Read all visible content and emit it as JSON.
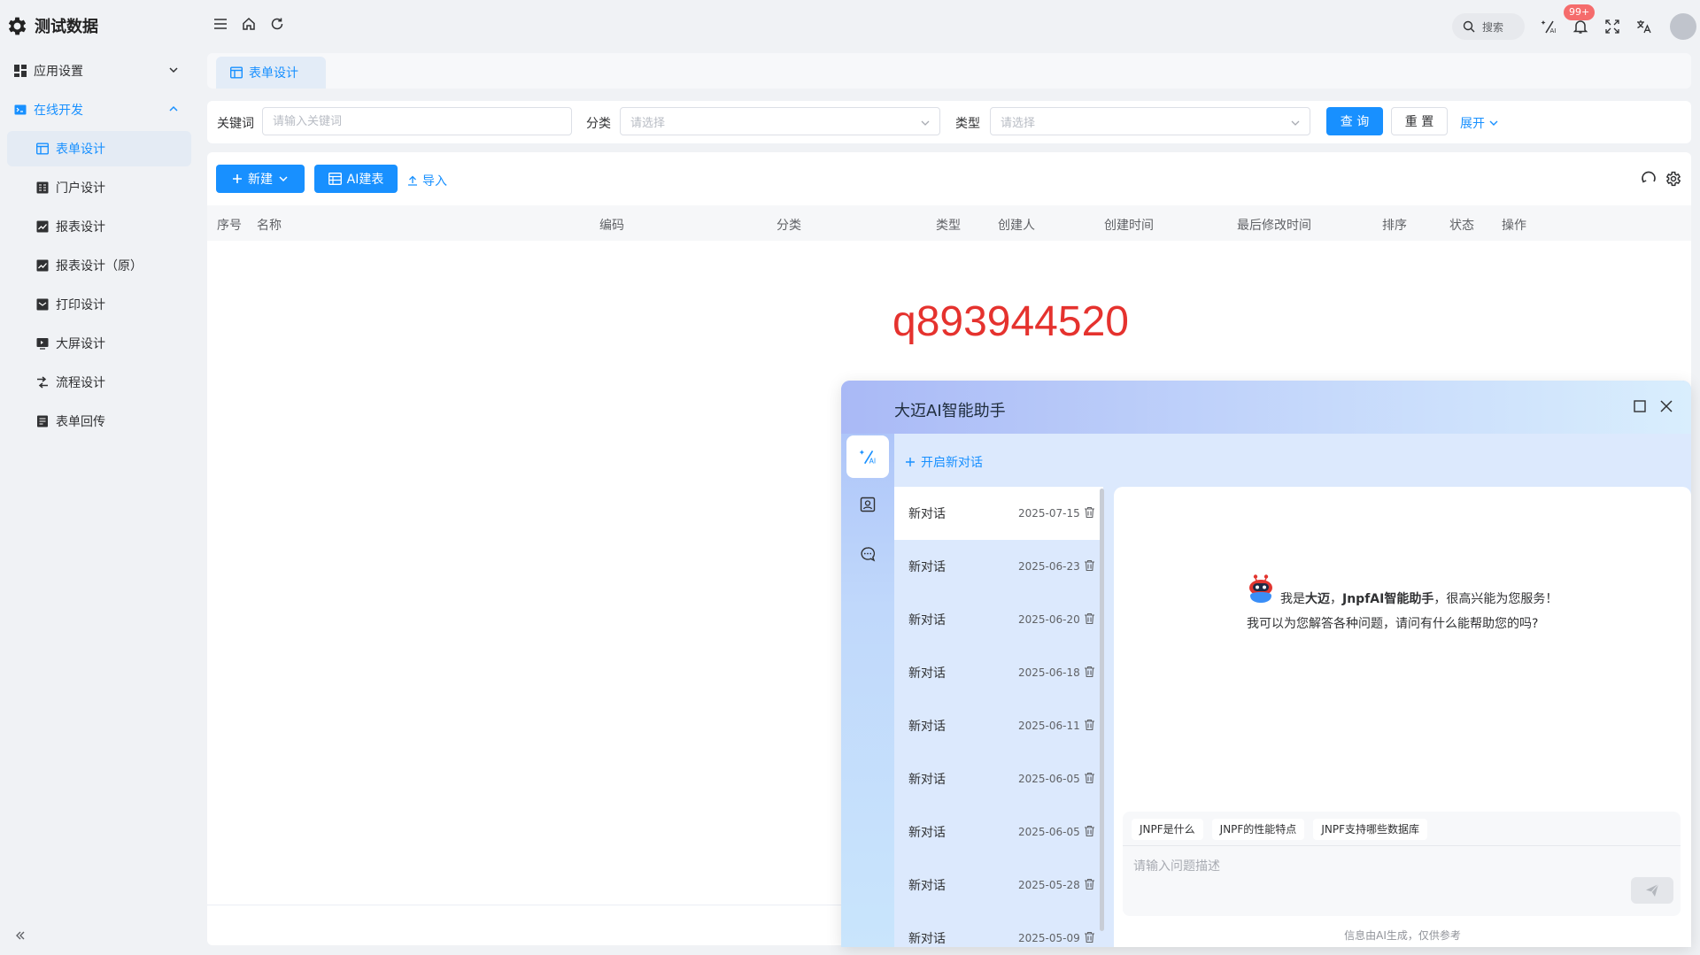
{
  "app": {
    "brand": "测试数据"
  },
  "sidebar": {
    "groups": [
      {
        "label": "应用设置"
      },
      {
        "label": "在线开发"
      }
    ],
    "items": [
      {
        "label": "表单设计"
      },
      {
        "label": "门户设计"
      },
      {
        "label": "报表设计"
      },
      {
        "label": "报表设计（原）"
      },
      {
        "label": "打印设计"
      },
      {
        "label": "大屏设计"
      },
      {
        "label": "流程设计"
      },
      {
        "label": "表单回传"
      }
    ]
  },
  "header": {
    "search_label": "搜索",
    "notification_badge": "99+"
  },
  "tabs": [
    {
      "label": "表单设计"
    }
  ],
  "search_form": {
    "keyword_label": "关键词",
    "keyword_placeholder": "请输入关键词",
    "category_label": "分类",
    "category_placeholder": "请选择",
    "type_label": "类型",
    "type_placeholder": "请选择",
    "query_label": "查 询",
    "reset_label": "重 置",
    "expand_label": "展开"
  },
  "toolbar": {
    "new_label": "新建",
    "ai_table_label": "AI建表",
    "import_label": "导入"
  },
  "table": {
    "columns": [
      "序号",
      "名称",
      "编码",
      "分类",
      "类型",
      "创建人",
      "创建时间",
      "最后修改时间",
      "排序",
      "状态",
      "操作"
    ]
  },
  "watermark": "q893944520",
  "ai_assistant": {
    "title": "大迈AI智能助手",
    "new_chat_label": "开启新对话",
    "conversations": [
      {
        "title": "新对话",
        "date": "2025-07-15"
      },
      {
        "title": "新对话",
        "date": "2025-06-23"
      },
      {
        "title": "新对话",
        "date": "2025-06-20"
      },
      {
        "title": "新对话",
        "date": "2025-06-18"
      },
      {
        "title": "新对话",
        "date": "2025-06-11"
      },
      {
        "title": "新对话",
        "date": "2025-06-05"
      },
      {
        "title": "新对话",
        "date": "2025-06-05"
      },
      {
        "title": "新对话",
        "date": "2025-05-28"
      },
      {
        "title": "新对话",
        "date": "2025-05-09"
      }
    ],
    "welcome": {
      "prefix": "我是",
      "name": "大迈",
      "comma": "，",
      "product": "JnpfAI智能助手",
      "suffix": "，很高兴能为您服务！",
      "line2": "我可以为您解答各种问题，请问有什么能帮助您的吗?"
    },
    "suggestions": [
      "JNPF是什么",
      "JNPF的性能特点",
      "JNPF支持哪些数据库"
    ],
    "input_placeholder": "请输入问题描述",
    "disclaimer": "信息由AI生成，仅供参考"
  },
  "colors": {
    "primary": "#1890ff",
    "watermark": "#e5322e",
    "badge": "#f56c6c"
  }
}
